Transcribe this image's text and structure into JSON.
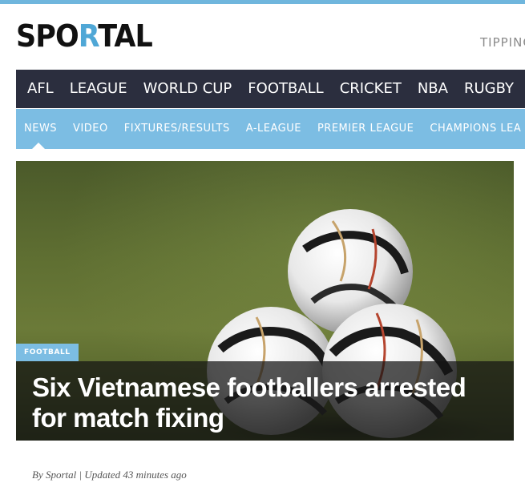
{
  "logo": {
    "pre": "SPO",
    "mid": "R",
    "post": "TAL"
  },
  "header": {
    "tipping": "TIPPING"
  },
  "primary_nav": [
    "AFL",
    "LEAGUE",
    "WORLD CUP",
    "FOOTBALL",
    "CRICKET",
    "NBA",
    "RUGBY"
  ],
  "secondary_nav": [
    "NEWS",
    "VIDEO",
    "FIXTURES/RESULTS",
    "A-LEAGUE",
    "PREMIER LEAGUE",
    "CHAMPIONS LEA"
  ],
  "article": {
    "category": "FOOTBALL",
    "headline": "Six Vietnamese footballers arrested for match fixing",
    "byline": "By Sportal |  Updated 43 minutes ago"
  },
  "colors": {
    "accent": "#7cbde3",
    "nav_dark": "#2b2e3e",
    "logo_accent": "#4fa7d6"
  }
}
